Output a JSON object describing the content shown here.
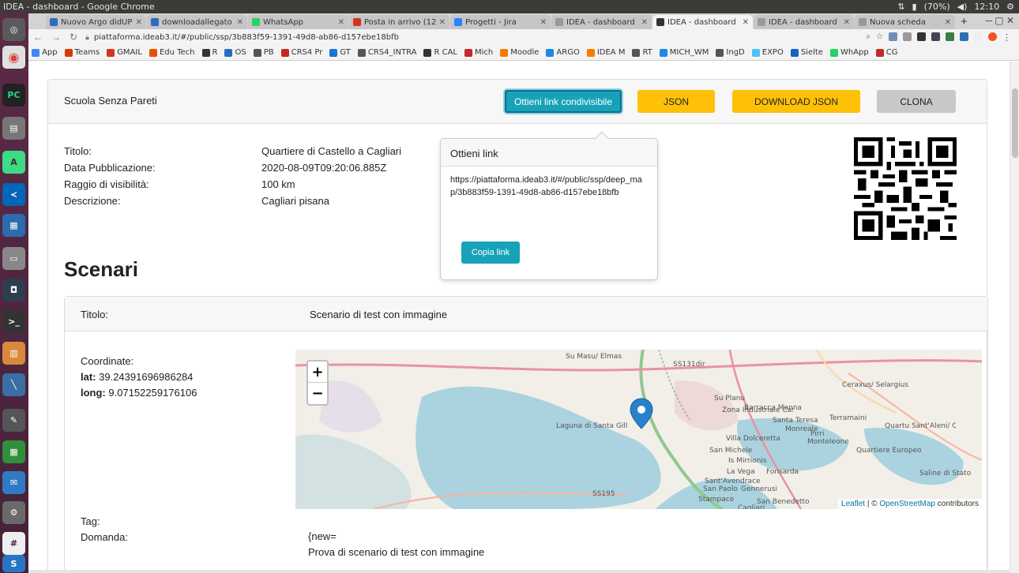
{
  "os": {
    "window_title": "IDEA - dashboard - Google Chrome",
    "battery": "(70%)",
    "clock": "12:10"
  },
  "browser": {
    "tabs": [
      {
        "label": "Nuovo Argo didUP",
        "color": "#2a6ebb"
      },
      {
        "label": "downloadallegato",
        "color": "#2a6ebb"
      },
      {
        "label": "WhatsApp",
        "color": "#25d366"
      },
      {
        "label": "Posta in arrivo (12.",
        "color": "#d93025"
      },
      {
        "label": "Progetti - Jira",
        "color": "#2684ff"
      },
      {
        "label": "IDEA - dashboard",
        "color": "#999999"
      },
      {
        "label": "IDEA - dashboard",
        "color": "#333333",
        "active": true
      },
      {
        "label": "IDEA - dashboard",
        "color": "#999999"
      },
      {
        "label": "Nuova scheda",
        "color": "#999999"
      }
    ],
    "url": "piattaforma.ideab3.it/#/public/ssp/3b883f59-1391-49d8-ab86-d157ebe18bfb",
    "bookmarks": [
      {
        "label": "App",
        "color": "#4285f4"
      },
      {
        "label": "Teams",
        "color": "#d83b01"
      },
      {
        "label": "GMAIL",
        "color": "#d93025"
      },
      {
        "label": "Edu Tech",
        "color": "#e65100"
      },
      {
        "label": "R",
        "color": "#333333"
      },
      {
        "label": "OS",
        "color": "#2a6ebb"
      },
      {
        "label": "PB",
        "color": "#555555"
      },
      {
        "label": "CRS4 Pr",
        "color": "#c62828"
      },
      {
        "label": "GT",
        "color": "#1976d2"
      },
      {
        "label": "CRS4_INTRA",
        "color": "#555555"
      },
      {
        "label": "R CAL",
        "color": "#333333"
      },
      {
        "label": "Mich",
        "color": "#c62828"
      },
      {
        "label": "Moodle",
        "color": "#f57c00"
      },
      {
        "label": "ARGO",
        "color": "#1e88e5"
      },
      {
        "label": "IDEA M",
        "color": "#f57c00"
      },
      {
        "label": "RT",
        "color": "#555555"
      },
      {
        "label": "MICH_WM",
        "color": "#1e88e5"
      },
      {
        "label": "IngD",
        "color": "#555555"
      },
      {
        "label": "EXPO",
        "color": "#4fc3f7"
      },
      {
        "label": "Sielte",
        "color": "#1565c0"
      },
      {
        "label": "WhApp",
        "color": "#25d366"
      },
      {
        "label": "CG",
        "color": "#c62828"
      }
    ]
  },
  "page": {
    "card_title": "Scuola Senza Pareti",
    "buttons": {
      "share": "Ottieni link condivisibile",
      "json": "JSON",
      "download": "DOWNLOAD JSON",
      "clone": "CLONA"
    },
    "meta": [
      {
        "label": "Titolo:",
        "value": "Quartiere di Castello a Cagliari"
      },
      {
        "label": "Data Pubblicazione:",
        "value": "2020-08-09T09:20:06.885Z"
      },
      {
        "label": "Raggio di visibilità:",
        "value": "100 km"
      },
      {
        "label": "Descrizione:",
        "value": "Cagliari pisana"
      }
    ],
    "scenari_heading": "Scenari",
    "scenario": {
      "title_label": "Titolo:",
      "title_value": "Scenario di test con immagine",
      "coord_label": "Coordinate:",
      "lat_label": "lat:",
      "lat_value": "39.24391696986284",
      "long_label": "long:",
      "long_value": "9.07152259176106",
      "tag_label": "Tag:",
      "domanda_label": "Domanda:",
      "domanda_lines": [
        "{new=",
        "Prova di scenario di test con immagine",
        "}"
      ]
    },
    "map": {
      "attribution_leaflet": "Leaflet",
      "attribution_sep": " | © ",
      "attribution_osm": "OpenStreetMap",
      "attribution_tail": " contributors",
      "zoom_in": "+",
      "zoom_out": "−",
      "labels": [
        "Su Masu/ Elmas",
        "SS131dir",
        "Su Planu",
        "Barracca Manna",
        "Ceraxus/ Selargius",
        "Zona Industriale Casic",
        "Laguna di Santa Gilla",
        "Villa Dolceretta",
        "Quartu Sant'Aleni/ Quartu Sant'Elena",
        "Monteleone",
        "Quartiere Europeo",
        "San Michele",
        "Is Mirrionis",
        "La Vega",
        "Fonsarda",
        "SS195",
        "Saline di Stato",
        "Sant'Avendrace",
        "San Paolo",
        "Gennerusi",
        "Stampace",
        "San Benedetto",
        "Cagliari",
        "Santa Teresa",
        "Monreale",
        "Terramaini",
        "Pirri"
      ]
    },
    "popover": {
      "title": "Ottieni link",
      "link": "https://piattaforma.ideab3.it/#/public/ssp/deep_map/3b883f59-1391-49d8-ab86-d157ebe18bfb",
      "copy_button": "Copia link"
    }
  }
}
